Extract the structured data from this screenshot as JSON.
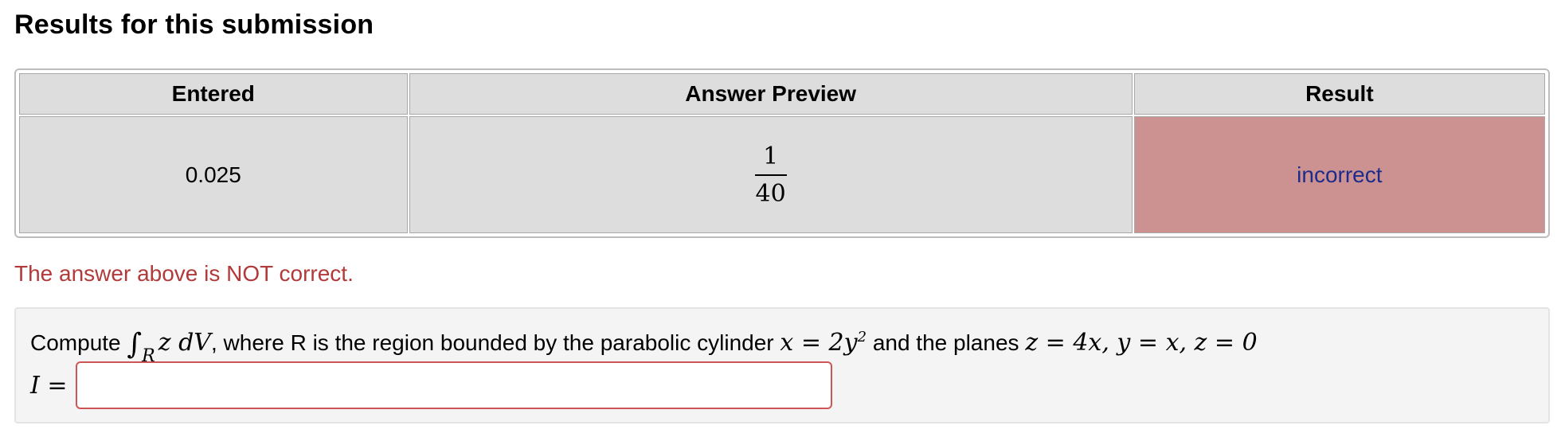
{
  "heading": "Results for this submission",
  "table": {
    "headers": [
      "Entered",
      "Answer Preview",
      "Result"
    ],
    "row": {
      "entered": "0.025",
      "preview": {
        "numerator": "1",
        "denominator": "40"
      },
      "result": "incorrect"
    }
  },
  "status_message": "The answer above is NOT correct.",
  "problem": {
    "text_compute": "Compute",
    "integral_sign": "∫",
    "integral_sub": "R",
    "integrand": "z dV",
    "text_where": ", where R is the region bounded by the parabolic cylinder",
    "cylinder_lhs": "x = 2y",
    "cylinder_exp": "2",
    "text_and": "and the planes",
    "planes": "z = 4x,  y = x,  z = 0",
    "answer_var": "I",
    "answer_eq": "=",
    "answer_value": "",
    "answer_placeholder": ""
  },
  "colors": {
    "result_incorrect_bg": "#cc9292",
    "result_text": "#1d2b8a",
    "status_text": "#b23a3a",
    "input_border": "#cc5555"
  }
}
